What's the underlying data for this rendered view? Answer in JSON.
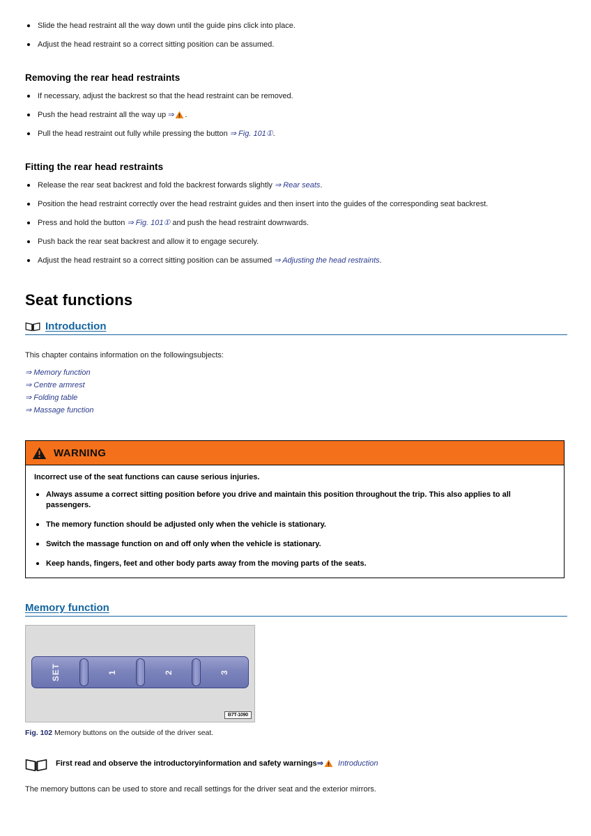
{
  "top_bullets": [
    "Slide the head restraint all the way down until the guide pins click into place.",
    "Adjust the head restraint so a correct sitting position can be assumed."
  ],
  "removing": {
    "heading": "Removing the rear head restraints",
    "items": [
      {
        "text": "If necessary, adjust the backrest so that the head restraint can be removed.",
        "icon": "",
        "xref": "",
        "tail": ""
      },
      {
        "text": "Push the head restraint all the way up ",
        "icon": "warning-triangle",
        "xref": "",
        "tail": "."
      },
      {
        "text": "Pull the head restraint out fully while pressing the button ",
        "icon": "",
        "xref": "⇒ Fig. 101①",
        "tail": "."
      }
    ]
  },
  "fitting": {
    "heading": "Fitting the rear head restraints",
    "items": [
      {
        "text": "Release the rear seat backrest and fold the backrest forwards slightly ",
        "icon": "",
        "xref": "⇒ Rear seats",
        "tail": "."
      },
      {
        "text": "Position the head restraint correctly over the head restraint guides and then insert into the guides of the corresponding seat backrest.",
        "icon": "",
        "xref": "",
        "tail": ""
      },
      {
        "text": "Press and hold the button ",
        "icon": "",
        "xref": "⇒ Fig. 101①",
        "tail": " and push the head restraint downwards."
      },
      {
        "text": "Push back the rear seat backrest and allow it to engage securely.",
        "icon": "",
        "xref": "",
        "tail": ""
      },
      {
        "text": "Adjust the head restraint so a correct sitting position can be assumed ",
        "icon": "",
        "xref": "⇒ Adjusting the head restraints",
        "tail": "."
      }
    ]
  },
  "chapter_title": "Seat functions",
  "introduction": {
    "heading": "Introduction",
    "icon": "book-icon",
    "intro_text": "This chapter contains information on the followingsubjects:",
    "links": [
      "⇒ Memory function",
      "⇒ Centre armrest",
      "⇒ Folding table",
      "⇒ Massage function"
    ]
  },
  "warning": {
    "title": "WARNING",
    "icon": "warning-triangle-icon",
    "header_color": "#F4701A",
    "lead": "Incorrect use of the seat functions can cause serious injuries.",
    "items": [
      "Always assume a correct sitting position before you drive and maintain this position throughout the trip. This also applies to all passengers.",
      "The memory function should be adjusted only when the vehicle is stationary.",
      "Switch the massage function on and off only when the vehicle is stationary.",
      "Keep hands, fingers, feet and other body parts away from the moving parts of the seats."
    ]
  },
  "memory_function": {
    "heading": "Memory function",
    "figure": {
      "buttons": [
        "SET",
        "1",
        "2",
        "3"
      ],
      "image_code": "B7T-1090",
      "caption_number": "Fig. 102",
      "caption_text": " Memory buttons on the outside of the driver seat."
    },
    "note": {
      "icon": "book-icon",
      "bold_text": "First read and observe the introductoryinformation and safety warnings",
      "arrow": "⇒",
      "warn_icon": "warning-triangle",
      "link": "Introduction"
    },
    "body_text": "The memory buttons can be used to store and recall settings for the driver seat and the exterior mirrors."
  }
}
